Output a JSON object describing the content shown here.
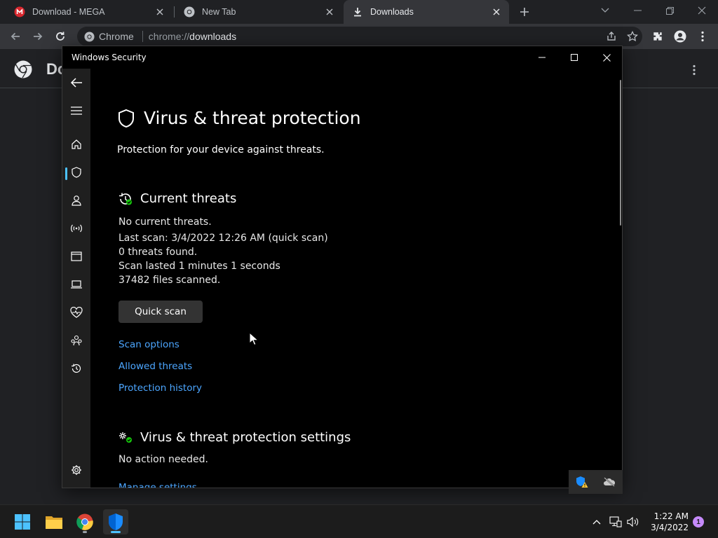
{
  "browser": {
    "tabs": [
      {
        "title": "Download - MEGA",
        "icon": "mega-icon"
      },
      {
        "title": "New Tab",
        "icon": "chrome-icon"
      },
      {
        "title": "Downloads",
        "icon": "download-icon",
        "active": true
      }
    ],
    "omnibox": {
      "chip_label": "Chrome",
      "url_scheme": "chrome://",
      "url_host": "downloads"
    }
  },
  "downloads_page": {
    "title_visible": "Do"
  },
  "security_window": {
    "window_title": "Windows Security",
    "page_title": "Virus & threat protection",
    "page_subtitle": "Protection for your device against threats.",
    "current_threats": {
      "heading": "Current threats",
      "lines": [
        "No current threats.",
        "Last scan: 3/4/2022 12:26 AM (quick scan)",
        "0 threats found.",
        "Scan lasted 1 minutes 1 seconds",
        "37482 files scanned."
      ],
      "quick_scan_label": "Quick scan",
      "links": [
        "Scan options",
        "Allowed threats",
        "Protection history"
      ]
    },
    "settings_section": {
      "heading": "Virus & threat protection settings",
      "status": "No action needed.",
      "link": "Manage settings"
    }
  },
  "taskbar": {
    "time": "1:22 AM",
    "date": "3/4/2022",
    "notification_count": "1"
  },
  "colors": {
    "accent": "#4cc2ff",
    "link": "#4ca6ff",
    "shield_green": "#16c60c"
  }
}
